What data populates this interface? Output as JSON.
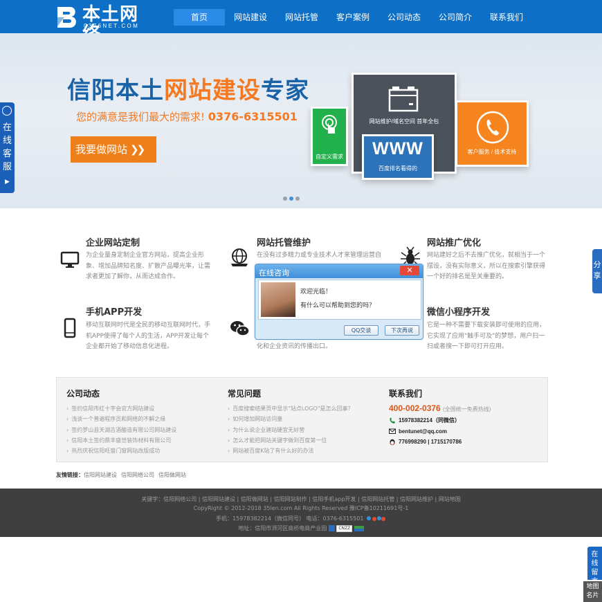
{
  "header": {
    "logo_name": "本土网络",
    "logo_sub": "0376NET.COM",
    "nav": [
      "首页",
      "网站建设",
      "网站托管",
      "客户案例",
      "公司动态",
      "公司简介",
      "联系我们"
    ]
  },
  "banner": {
    "title_a": "信阳本土",
    "title_b": "网站建设",
    "title_c": "专家",
    "subtitle": "您的满意是我们最大的需求!",
    "phone": "0376-6315501",
    "cta": "我要做网站",
    "tile_green": "自定义需求",
    "tile_dark": "网站维护/域名空间 首年全包",
    "tile_blue_big": "WWW",
    "tile_blue": "百度排名看得的",
    "tile_orange": "客户服务 / 技术支持",
    "slide_count": 3,
    "active_slide": 2
  },
  "services": [
    {
      "title": "企业网站定制",
      "desc": "为企业量身定制企业官方网站，提高企业形象、增加品牌知名度、扩散产品曝光率，让需求者更加了解你，从而达成合作。",
      "icon": "monitor-icon"
    },
    {
      "title": "网站托管维护",
      "desc": "在没有过多精力或专业技术人才来管理运营自",
      "icon": "globe-icon"
    },
    {
      "title": "网站推广优化",
      "desc": "网站建好之后不去推广优化，就相当于一个摆设，没有实际意义，所以在搜索引擎获得一个好的排名是至关重要的。",
      "icon": "spider-icon"
    },
    {
      "title": "手机APP开发",
      "desc": "移动互联网时代是全民的移动互联网时代，手机APP使得了每个人的生活，APP开发让每个企业都开始了移动信息化进程。",
      "icon": "phone-icon"
    },
    {
      "title": "",
      "desc": "化和企业资讯的传播出口。",
      "icon": "wechat-icon"
    },
    {
      "title": "微信小程序开发",
      "desc": "它是一种不需要下载安装即可使用的应用，它实现了应用\"触手可及\"的梦想，用户扫一扫或者搜一下即可打开应用。",
      "icon": ""
    }
  ],
  "chat": {
    "title": "在线咨询",
    "close": "✕",
    "line1": "欢迎光临！",
    "line2": "有什么可以帮助到您的吗？",
    "btn_qq": "QQ交谈",
    "btn_later": "下次再说"
  },
  "info": {
    "news_title": "公司动态",
    "news": [
      "签约信阳市红十字会官方网站建设",
      "浅谈一个普遍程序员和网络的不解之缘",
      "签约罗山县天湖古酒酿造有限公司网站建设",
      "信阳本土签约鼎丰盛世装饰材料有限公司",
      "热烈庆祝信阳旺盛门窗网站改版成功"
    ],
    "faq_title": "常见问题",
    "faq": [
      "百度搜索结果页中显示\"站点LOGO\"是怎么回事？",
      "如何增加网站访问量",
      "为什么说企业建站硬宜无好营",
      "怎么才能把网站关键字做到百度第一位",
      "网站被百度K站了有什么好的办法"
    ],
    "contact_title": "联系我们",
    "hotline": "400-002-0376",
    "hotline_note": "(全国统一免费热线)",
    "phone": "15978382214（同微信）",
    "email": "bentunet@qq.com",
    "qq": "776998290 | 1715170786"
  },
  "links": {
    "label": "友情链接：",
    "items": [
      "信阳网站建设",
      "信阳网络公司",
      "信阳做网站"
    ]
  },
  "footer": {
    "keywords": "关键字：信阳网络公司 | 信阳网站建设 | 信阳做网站 | 信阳网站制作 | 信阳手机app开发 | 信阳网站托管 | 信阳网站维护 | 网站地图",
    "copyright": "CopyRight © 2012-2018 35len.com All Rights Reserved   豫ICP备10211691号-1",
    "contact": "手机：15978382214（微信同号）   电话：0376-6315501",
    "address": "地址：信阳市浉河区商桥电商产业园",
    "badge": "CNZZ"
  },
  "widgets": {
    "kefu": "在线客服",
    "share": "分享",
    "message": "在线留言",
    "map": "地图名片"
  },
  "colors": {
    "brand_blue": "#0d6fc5",
    "accent_orange": "#f47920",
    "footer_bg": "#3f3f3f"
  }
}
